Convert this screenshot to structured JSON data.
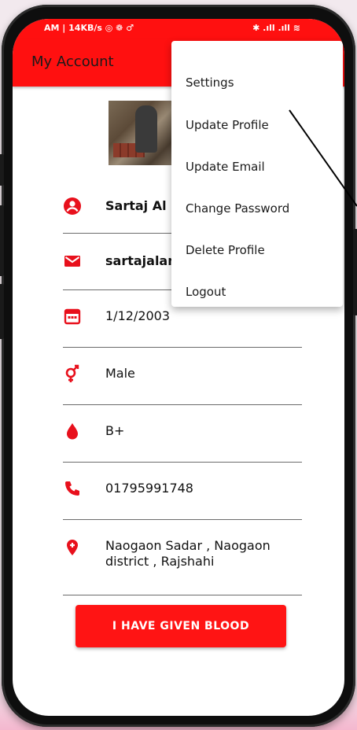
{
  "statusbar": {
    "left": "AM | 14KB/s ◎ ❁ ♂",
    "right": "✱ .ıll .ıll ≋"
  },
  "appbar": {
    "title": "My Account"
  },
  "profile": {
    "name": "Sartaj Al",
    "email": "sartajalan",
    "dob": "1/12/2003",
    "gender": "Male",
    "blood_group": "B+",
    "phone": "01795991748",
    "address": "Naogaon Sadar , Naogaon district , Rajshahi"
  },
  "cta_label": "I HAVE GIVEN BLOOD",
  "menu": {
    "items": [
      "Settings",
      "Update Profile",
      "Update Email",
      "Change Password",
      "Delete Profile",
      "Logout"
    ]
  },
  "colors": {
    "accent": "#ff1010",
    "icon": "#e8101c"
  },
  "icons": [
    "person-icon",
    "mail-icon",
    "calendar-icon",
    "gender-icon",
    "blood-drop-icon",
    "phone-icon",
    "location-icon"
  ]
}
